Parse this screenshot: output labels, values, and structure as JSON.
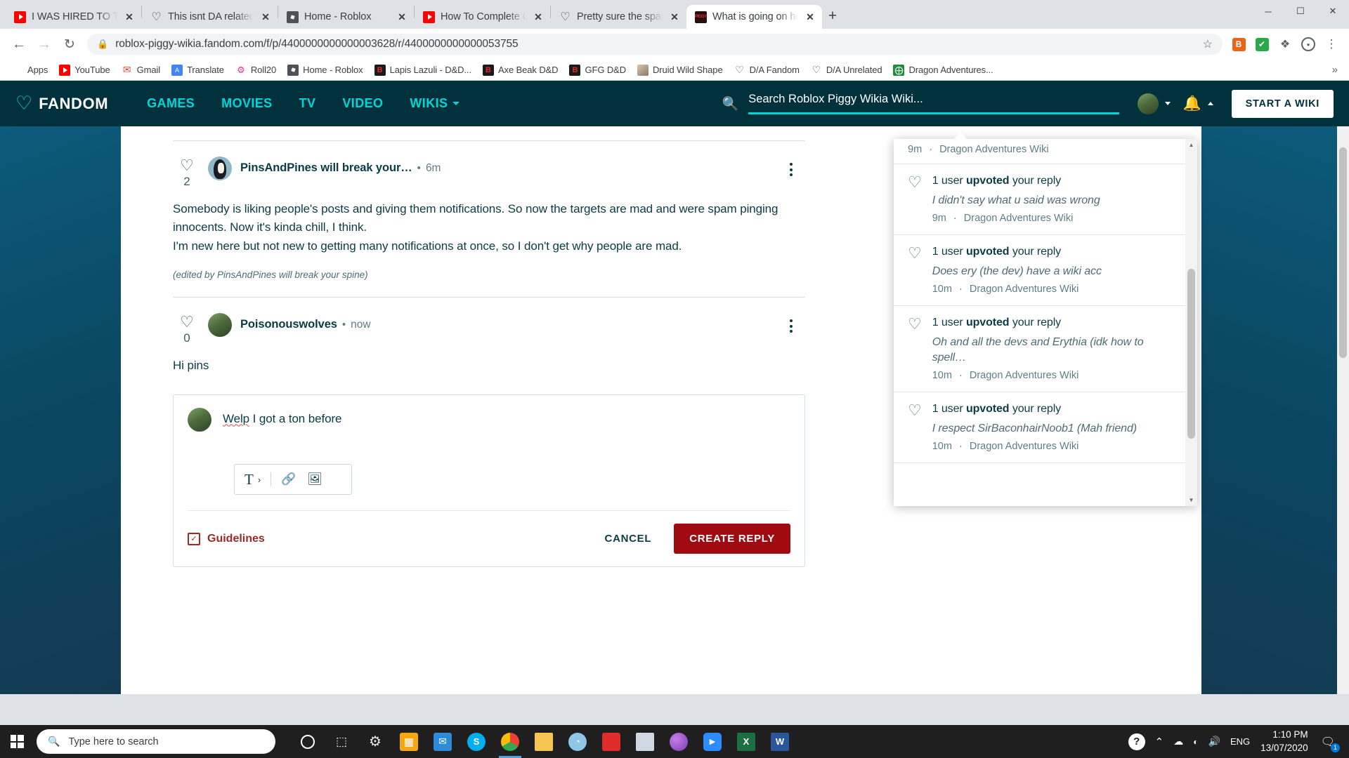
{
  "browser": {
    "tabs": [
      {
        "title": "I WAS HIRED TO TARGET TOXIC",
        "favicon": "youtube-icon",
        "active": false,
        "close_label": "✕"
      },
      {
        "title": "This isnt DA related, but i need",
        "favicon": "fandom-icon",
        "active": false,
        "close_label": "✕"
      },
      {
        "title": "Home - Roblox",
        "favicon": "roblox-icon",
        "active": false,
        "close_label": "✕"
      },
      {
        "title": "How To Complete CRYPTID H",
        "favicon": "youtube-icon",
        "active": false,
        "close_label": "✕"
      },
      {
        "title": "Pretty sure the spam upvoter",
        "favicon": "fandom-icon",
        "active": false,
        "close_label": "✕"
      },
      {
        "title": "What is going on here? | Fan",
        "favicon": "piggy-icon",
        "active": true,
        "close_label": "✕"
      }
    ],
    "new_tab_label": "+",
    "window_controls": {
      "minimize": "─",
      "maximize": "☐",
      "close": "✕"
    },
    "nav": {
      "back": "←",
      "forward": "→",
      "reload": "↻"
    },
    "omnibox": {
      "lock_icon": "lock-icon",
      "url": "roblox-piggy-wikia.fandom.com/f/p/4400000000000003628/r/4400000000000053755",
      "star_icon": "☆"
    },
    "toolbar_icons": [
      {
        "name": "brave-extension-icon",
        "glyph": "B"
      },
      {
        "name": "checkmark-extension-icon",
        "glyph": "✔"
      },
      {
        "name": "puzzle-extensions-icon",
        "glyph": "❖"
      },
      {
        "name": "profile-avatar-icon",
        "glyph": "●"
      },
      {
        "name": "chrome-menu-icon",
        "glyph": "⋮"
      }
    ],
    "bookmarks": [
      {
        "label": "Apps",
        "icon": "apps-grid-icon"
      },
      {
        "label": "YouTube",
        "icon": "youtube-icon"
      },
      {
        "label": "Gmail",
        "icon": "gmail-icon"
      },
      {
        "label": "Translate",
        "icon": "translate-icon"
      },
      {
        "label": "Roll20",
        "icon": "roll20-icon"
      },
      {
        "label": "Home - Roblox",
        "icon": "roblox-icon"
      },
      {
        "label": "Lapis Lazuli - D&D...",
        "icon": "bestiary-icon"
      },
      {
        "label": "Axe Beak D&D",
        "icon": "bestiary-icon"
      },
      {
        "label": "GFG D&D",
        "icon": "bestiary-icon"
      },
      {
        "label": "Druid Wild Shape",
        "icon": "photo-icon"
      },
      {
        "label": "D/A Fandom",
        "icon": "fandom-icon"
      },
      {
        "label": "D/A Unrelated",
        "icon": "fandom-icon"
      },
      {
        "label": "Dragon Adventures...",
        "icon": "sheets-icon"
      }
    ],
    "bookmarks_overflow": "»"
  },
  "fandom": {
    "logo_wordmark": "FANDOM",
    "nav": [
      {
        "label": "GAMES",
        "has_caret": false
      },
      {
        "label": "MOVIES",
        "has_caret": false
      },
      {
        "label": "TV",
        "has_caret": false
      },
      {
        "label": "VIDEO",
        "has_caret": false
      },
      {
        "label": "WIKIS",
        "has_caret": true
      }
    ],
    "search": {
      "placeholder": "Search Roblox Piggy Wikia Wiki...",
      "icon": "search-icon"
    },
    "user": {
      "avatar": "user-avatar",
      "bell": "notification-bell-icon"
    },
    "start_wiki_label": "START A WIKI"
  },
  "thread": {
    "posts": [
      {
        "author": "PinsAndPines will break your…",
        "time": "6m",
        "votes": "2",
        "avatar": "pins-avatar",
        "body_lines": [
          "Somebody is liking people's posts and giving them notifications. So now the targets are mad and",
          "were spam pinging innocents. Now it's kinda chill, I think.",
          "I'm new here but not new to getting many notifications at once, so I don't get why people are mad."
        ],
        "edited_note": "(edited by PinsAndPines will break your spine)"
      },
      {
        "author": "Poisonouswolves",
        "time": "now",
        "votes": "0",
        "avatar": "wolves-avatar",
        "body_lines": [
          "Hi pins"
        ],
        "edited_note": ""
      }
    ]
  },
  "reply_editor": {
    "avatar": "wolves-avatar",
    "draft_misspelled_word": "Welp",
    "draft_rest": " I got a ton before",
    "toolbar": {
      "text_style_icon": "text-format-icon",
      "text_style_glyph": "T",
      "chevron_glyph": "›",
      "link_icon": "link-icon",
      "image_icon": "image-icon"
    },
    "guidelines_label": "Guidelines",
    "guidelines_icon": "guidelines-check-icon",
    "cancel_label": "CANCEL",
    "create_label": "CREATE REPLY"
  },
  "notifications": {
    "partial_top": {
      "meta_time": "9m",
      "meta_wiki": "Dragon Adventures Wiki"
    },
    "items": [
      {
        "head_prefix": "1 user ",
        "head_bold": "upvoted",
        "head_suffix": " your reply",
        "snippet": "I didn't say what u said was wrong",
        "time": "9m",
        "wiki": "Dragon Adventures Wiki",
        "icon": "heart-icon"
      },
      {
        "head_prefix": "1 user ",
        "head_bold": "upvoted",
        "head_suffix": " your reply",
        "snippet": "Does ery (the dev) have a wiki acc",
        "time": "10m",
        "wiki": "Dragon Adventures Wiki",
        "icon": "heart-icon"
      },
      {
        "head_prefix": "1 user ",
        "head_bold": "upvoted",
        "head_suffix": " your reply",
        "snippet": "Oh and all the devs and Erythia (idk how to spell…",
        "time": "10m",
        "wiki": "Dragon Adventures Wiki",
        "icon": "heart-icon"
      },
      {
        "head_prefix": "1 user ",
        "head_bold": "upvoted",
        "head_suffix": " your reply",
        "snippet": "I respect SirBaconhairNoob1 (Mah friend)",
        "time": "10m",
        "wiki": "Dragon Adventures Wiki",
        "icon": "heart-icon"
      }
    ],
    "scroll_up": "▲",
    "scroll_down": "▼",
    "separator": "·"
  },
  "taskbar": {
    "start_icon": "windows-start-icon",
    "search": {
      "placeholder": "Type here to search",
      "icon": "search-icon"
    },
    "apps": [
      {
        "name": "cortana-icon",
        "glyph": "○",
        "color": "transparent",
        "active": false
      },
      {
        "name": "task-view-icon",
        "glyph": "⬚",
        "color": "transparent",
        "active": false
      },
      {
        "name": "settings-icon",
        "glyph": "⚙",
        "color": "transparent",
        "active": false
      },
      {
        "name": "microsoft-store-icon",
        "glyph": "⊞",
        "color": "#f3a712",
        "active": false
      },
      {
        "name": "mail-icon",
        "glyph": "✉",
        "color": "#2e8bd8",
        "active": false
      },
      {
        "name": "skype-icon",
        "glyph": "S",
        "color": "#00aff0",
        "active": false
      },
      {
        "name": "chrome-icon",
        "glyph": "◉",
        "color": "#4fa3e3",
        "active": true
      },
      {
        "name": "file-explorer-icon",
        "glyph": "▬",
        "color": "#f5c451",
        "active": false
      },
      {
        "name": "paint-net-icon",
        "glyph": "◑",
        "color": "#8fc6e8",
        "active": false
      },
      {
        "name": "roblox-studio-icon",
        "glyph": "◆",
        "color": "#e02b2b",
        "active": false
      },
      {
        "name": "sticky-notes-icon",
        "glyph": "■",
        "color": "#cfd8e3",
        "active": false
      },
      {
        "name": "firefox-icon",
        "glyph": "●",
        "color": "#9b6ce0",
        "active": false
      },
      {
        "name": "zoom-icon",
        "glyph": "▶",
        "color": "#2d8cff",
        "active": false
      },
      {
        "name": "excel-icon",
        "glyph": "X",
        "color": "#1d6f42",
        "active": false
      },
      {
        "name": "word-icon",
        "glyph": "W",
        "color": "#2b579a",
        "active": false
      }
    ],
    "tray": [
      {
        "name": "help-icon",
        "glyph": "?"
      },
      {
        "name": "show-hidden-icons-icon",
        "glyph": "⌃"
      },
      {
        "name": "onedrive-icon",
        "glyph": "☁"
      },
      {
        "name": "network-icon",
        "glyph": "📶"
      },
      {
        "name": "volume-icon",
        "glyph": "🔊"
      }
    ],
    "language": "ENG",
    "time": "1:10 PM",
    "date": "13/07/2020",
    "action_center": {
      "icon": "action-center-icon",
      "glyph": "▭",
      "badge": "1"
    }
  }
}
